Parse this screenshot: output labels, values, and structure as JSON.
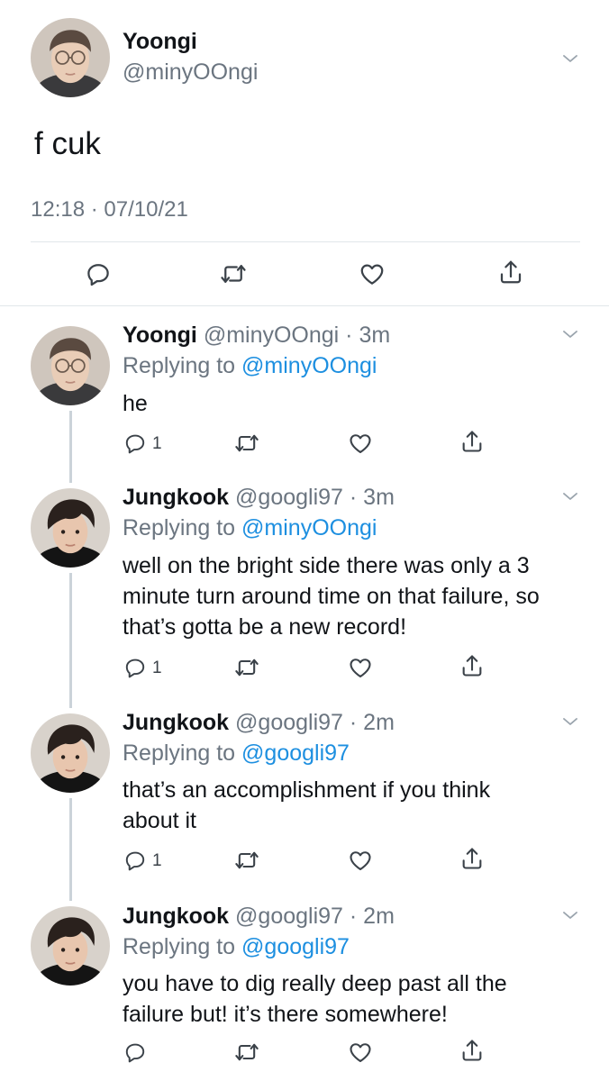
{
  "main_tweet": {
    "display_name": "Yoongi",
    "handle": "@minyOOngi",
    "text": "f cuk",
    "timestamp": "12:18 · 07/10/21"
  },
  "replies": [
    {
      "display_name": "Yoongi",
      "handle": "@minyOOngi",
      "age": "3m",
      "replying_label": "Replying to",
      "replying_to": "@minyOOngi",
      "text": "he",
      "reply_count": "1"
    },
    {
      "display_name": "Jungkook",
      "handle": "@googli97",
      "age": "3m",
      "replying_label": "Replying to",
      "replying_to": "@minyOOngi",
      "text_lines": [
        "well on the bright side there was only a 3",
        "minute turn around time on that failure, so",
        "that’s gotta be a new record!"
      ],
      "reply_count": "1"
    },
    {
      "display_name": "Jungkook",
      "handle": "@googli97",
      "age": "2m",
      "replying_label": "Replying to",
      "replying_to": "@googli97",
      "text_lines": [
        "that’s an accomplishment if you think",
        "about it"
      ],
      "reply_count": "1"
    },
    {
      "display_name": "Jungkook",
      "handle": "@googli97",
      "age": "2m",
      "replying_label": "Replying to",
      "replying_to": "@googli97",
      "text_lines": [
        "you have to dig really deep past all the",
        "failure but! it’s there somewhere!"
      ],
      "reply_count": ""
    }
  ],
  "icons": {
    "reply": "reply-icon",
    "retweet": "retweet-icon",
    "like": "heart-icon",
    "share": "share-icon",
    "menu": "chevron-down-icon"
  },
  "colors": {
    "link": "#1d8fe0",
    "muted": "#6b7580",
    "text": "#111418"
  }
}
